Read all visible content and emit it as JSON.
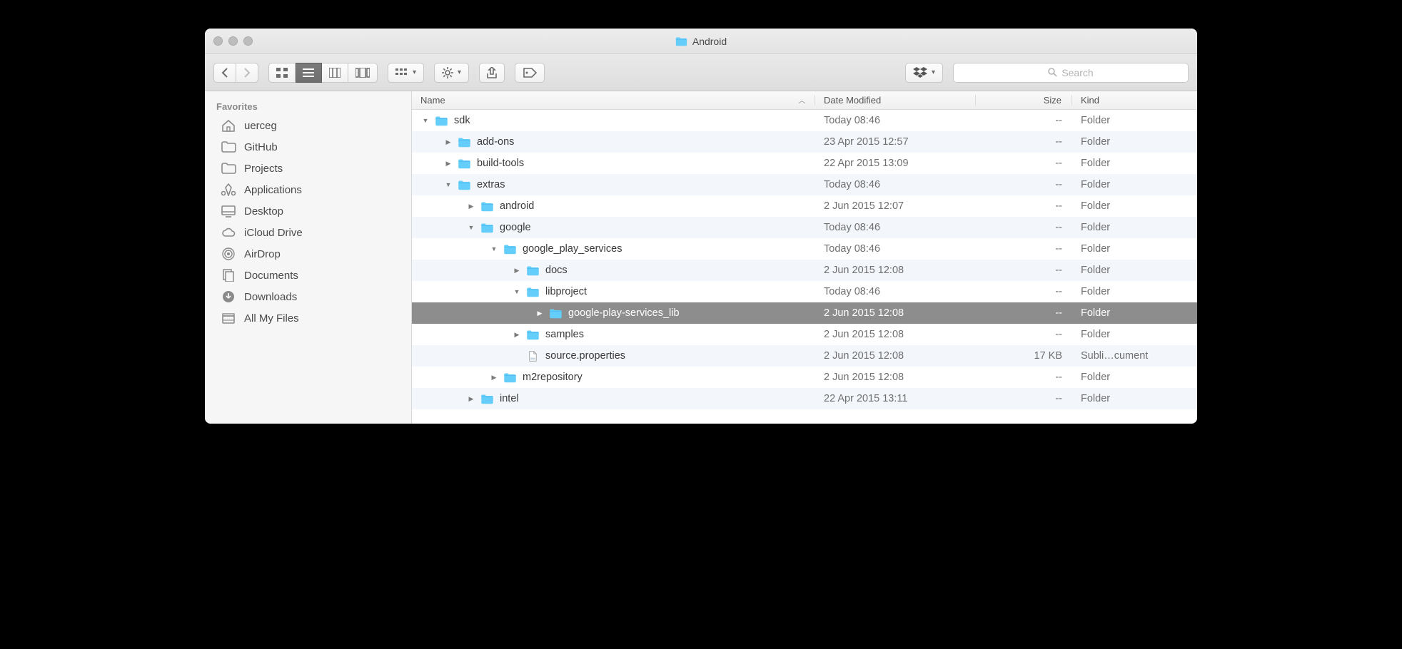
{
  "window": {
    "title": "Android"
  },
  "toolbar": {
    "search_placeholder": "Search"
  },
  "sidebar": {
    "heading": "Favorites",
    "items": [
      {
        "icon": "home",
        "label": "uerceg"
      },
      {
        "icon": "folder",
        "label": "GitHub"
      },
      {
        "icon": "folder",
        "label": "Projects"
      },
      {
        "icon": "apps",
        "label": "Applications"
      },
      {
        "icon": "desktop",
        "label": "Desktop"
      },
      {
        "icon": "cloud",
        "label": "iCloud Drive"
      },
      {
        "icon": "airdrop",
        "label": "AirDrop"
      },
      {
        "icon": "documents",
        "label": "Documents"
      },
      {
        "icon": "downloads",
        "label": "Downloads"
      },
      {
        "icon": "allfiles",
        "label": "All My Files"
      }
    ]
  },
  "columns": {
    "name": "Name",
    "date": "Date Modified",
    "size": "Size",
    "kind": "Kind",
    "sort": "name_asc"
  },
  "rows": [
    {
      "depth": 0,
      "arrow": "down",
      "icon": "folder",
      "name": "sdk",
      "date": "Today 08:46",
      "size": "--",
      "kind": "Folder",
      "selected": false
    },
    {
      "depth": 1,
      "arrow": "right",
      "icon": "folder",
      "name": "add-ons",
      "date": "23 Apr 2015 12:57",
      "size": "--",
      "kind": "Folder",
      "selected": false
    },
    {
      "depth": 1,
      "arrow": "right",
      "icon": "folder",
      "name": "build-tools",
      "date": "22 Apr 2015 13:09",
      "size": "--",
      "kind": "Folder",
      "selected": false
    },
    {
      "depth": 1,
      "arrow": "down",
      "icon": "folder",
      "name": "extras",
      "date": "Today 08:46",
      "size": "--",
      "kind": "Folder",
      "selected": false
    },
    {
      "depth": 2,
      "arrow": "right",
      "icon": "folder",
      "name": "android",
      "date": "2 Jun 2015 12:07",
      "size": "--",
      "kind": "Folder",
      "selected": false
    },
    {
      "depth": 2,
      "arrow": "down",
      "icon": "folder",
      "name": "google",
      "date": "Today 08:46",
      "size": "--",
      "kind": "Folder",
      "selected": false
    },
    {
      "depth": 3,
      "arrow": "down",
      "icon": "folder",
      "name": "google_play_services",
      "date": "Today 08:46",
      "size": "--",
      "kind": "Folder",
      "selected": false
    },
    {
      "depth": 4,
      "arrow": "right",
      "icon": "folder",
      "name": "docs",
      "date": "2 Jun 2015 12:08",
      "size": "--",
      "kind": "Folder",
      "selected": false
    },
    {
      "depth": 4,
      "arrow": "down",
      "icon": "folder",
      "name": "libproject",
      "date": "Today 08:46",
      "size": "--",
      "kind": "Folder",
      "selected": false
    },
    {
      "depth": 5,
      "arrow": "right",
      "icon": "folder",
      "name": "google-play-services_lib",
      "date": "2 Jun 2015 12:08",
      "size": "--",
      "kind": "Folder",
      "selected": true
    },
    {
      "depth": 4,
      "arrow": "right",
      "icon": "folder",
      "name": "samples",
      "date": "2 Jun 2015 12:08",
      "size": "--",
      "kind": "Folder",
      "selected": false
    },
    {
      "depth": 4,
      "arrow": "none",
      "icon": "file",
      "name": "source.properties",
      "date": "2 Jun 2015 12:08",
      "size": "17 KB",
      "kind": "Subli…cument",
      "selected": false
    },
    {
      "depth": 3,
      "arrow": "right",
      "icon": "folder",
      "name": "m2repository",
      "date": "2 Jun 2015 12:08",
      "size": "--",
      "kind": "Folder",
      "selected": false
    },
    {
      "depth": 2,
      "arrow": "right",
      "icon": "folder",
      "name": "intel",
      "date": "22 Apr 2015 13:11",
      "size": "--",
      "kind": "Folder",
      "selected": false
    }
  ]
}
